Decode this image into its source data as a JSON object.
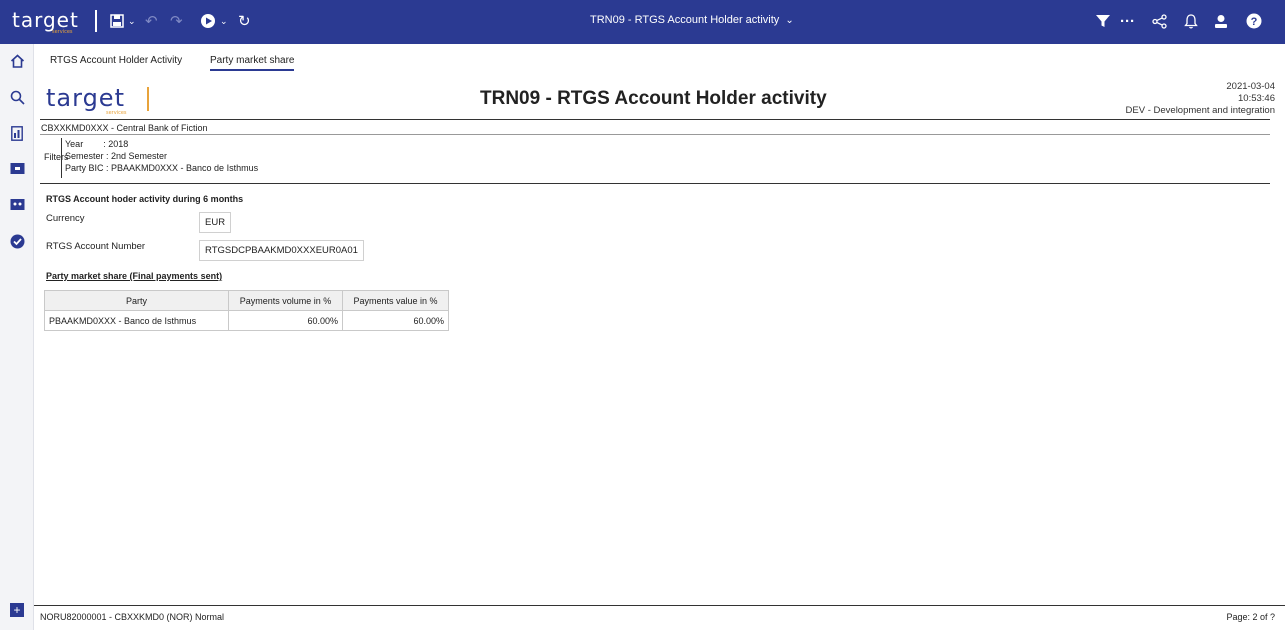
{
  "app": {
    "logo": "target",
    "logo_sub": "services",
    "window_title": "TRN09 - RTGS Account Holder activity"
  },
  "toolbar": {
    "icons": [
      "save-icon",
      "undo-icon",
      "redo-icon",
      "run-icon",
      "refresh-icon",
      "filter-icon",
      "more-icon",
      "share-icon",
      "bell-icon",
      "user-icon",
      "help-icon"
    ]
  },
  "sidebar": {
    "icons": [
      "home-icon",
      "search-icon",
      "report-icon",
      "folder-icon",
      "team-folder-icon",
      "check-icon",
      "add-icon"
    ]
  },
  "tabs": [
    {
      "label": "RTGS Account Holder Activity"
    },
    {
      "label": "Party market share"
    }
  ],
  "report": {
    "logo": "target",
    "logo_sub": "services",
    "title": "TRN09 - RTGS Account Holder activity",
    "date": "2021-03-04",
    "time": "10:53:46",
    "environment": "DEV - Development and integration",
    "bank": "CBXXKMD0XXX - Central Bank of Fiction",
    "filters_label": "Filters",
    "filters": [
      "Year        : 2018",
      "Semester : 2nd Semester",
      "Party BIC : PBAAKMD0XXX - Banco de Isthmus"
    ],
    "section_title": "RTGS Account hoder activity during 6 months",
    "currency_label": "Currency",
    "currency_value": "EUR",
    "account_label": "RTGS Account Number",
    "account_value": "RTGSDCPBAAKMD0XXXEUR0A01",
    "share_title": "Party market share (Final payments sent)",
    "table": {
      "headers": [
        "Party",
        "Payments volume in %",
        "Payments value in %"
      ],
      "rows": [
        [
          "PBAAKMD0XXX - Banco de Isthmus",
          "60.00%",
          "60.00%"
        ]
      ]
    }
  },
  "footer": {
    "left": "NORU82000001 - CBXXKMD0 (NOR) Normal",
    "right": "Page: 2 of ?"
  },
  "colors": {
    "brand": "#2b3a92",
    "accent": "#e8a33b"
  }
}
